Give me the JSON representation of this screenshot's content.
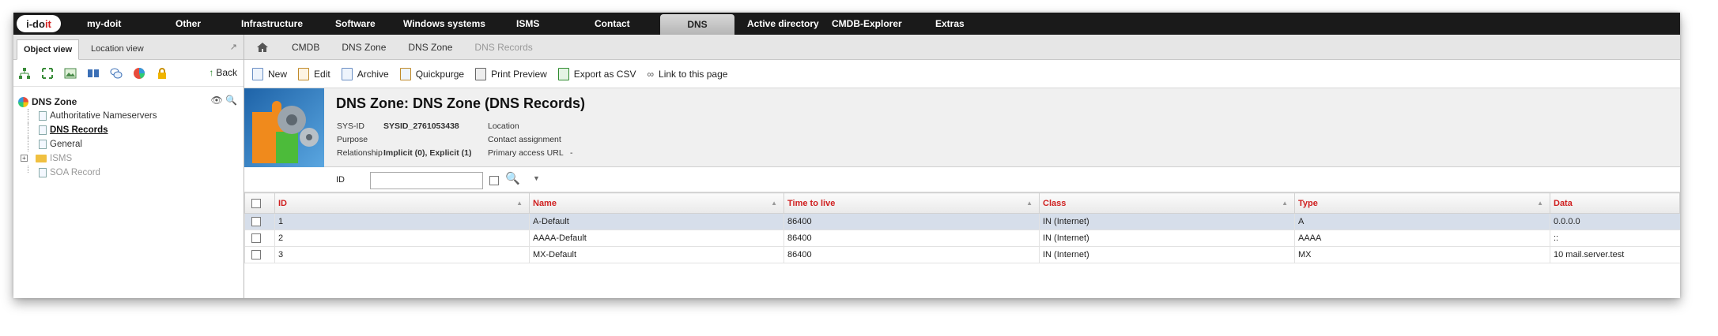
{
  "nav": {
    "logo_prefix": "i-do",
    "logo_suffix": "it",
    "items": [
      {
        "label": "my-doit"
      },
      {
        "label": "Other"
      },
      {
        "label": "Infrastructure"
      },
      {
        "label": "Software"
      },
      {
        "label": "Windows systems"
      },
      {
        "label": "ISMS"
      },
      {
        "label": "Contact"
      },
      {
        "label": "DNS"
      },
      {
        "label": "Active directory"
      },
      {
        "label": "CMDB-Explorer"
      },
      {
        "label": "Extras"
      }
    ],
    "active": "DNS"
  },
  "left": {
    "tabs": [
      {
        "label": "Object view"
      },
      {
        "label": "Location view"
      }
    ],
    "back_label": "Back",
    "tool_icons": [
      "tree-icon",
      "expand-icon",
      "image-icon",
      "book-icon",
      "comments-icon",
      "chart-icon",
      "lock-icon"
    ],
    "tree": {
      "root": "DNS Zone",
      "items": [
        {
          "label": "Authoritative Nameservers"
        },
        {
          "label": "DNS Records"
        },
        {
          "label": "General"
        },
        {
          "label": "ISMS"
        },
        {
          "label": "SOA Record"
        }
      ]
    }
  },
  "breadcrumb": {
    "items": [
      {
        "label": "CMDB"
      },
      {
        "label": "DNS Zone"
      },
      {
        "label": "DNS Zone"
      },
      {
        "label": "DNS Records"
      }
    ]
  },
  "toolbar": {
    "buttons": [
      {
        "label": "New"
      },
      {
        "label": "Edit"
      },
      {
        "label": "Archive"
      },
      {
        "label": "Quickpurge"
      },
      {
        "label": "Print Preview"
      },
      {
        "label": "Export as CSV"
      },
      {
        "label": "Link to this page"
      }
    ]
  },
  "object": {
    "title": "DNS Zone: DNS Zone (DNS Records)",
    "sysid_label": "SYS-ID",
    "sysid_value": "SYSID_2761053438",
    "purpose_label": "Purpose",
    "relationship_label": "Relationship",
    "relationship_value": "Implicit (0), Explicit (1)",
    "location_label": "Location",
    "contact_label": "Contact assignment",
    "access_label": "Primary access URL",
    "access_value": "-"
  },
  "filter": {
    "label": "ID",
    "value": ""
  },
  "table": {
    "columns": [
      "ID",
      "Name",
      "Time to live",
      "Class",
      "Type",
      "Data"
    ],
    "rows": [
      {
        "id": "1",
        "name": "A-Default",
        "ttl": "86400",
        "class": "IN (Internet)",
        "type": "A",
        "data": "0.0.0.0"
      },
      {
        "id": "2",
        "name": "AAAA-Default",
        "ttl": "86400",
        "class": "IN (Internet)",
        "type": "AAAA",
        "data": "::"
      },
      {
        "id": "3",
        "name": "MX-Default",
        "ttl": "86400",
        "class": "IN (Internet)",
        "type": "MX",
        "data": "10 mail.server.test"
      }
    ]
  }
}
